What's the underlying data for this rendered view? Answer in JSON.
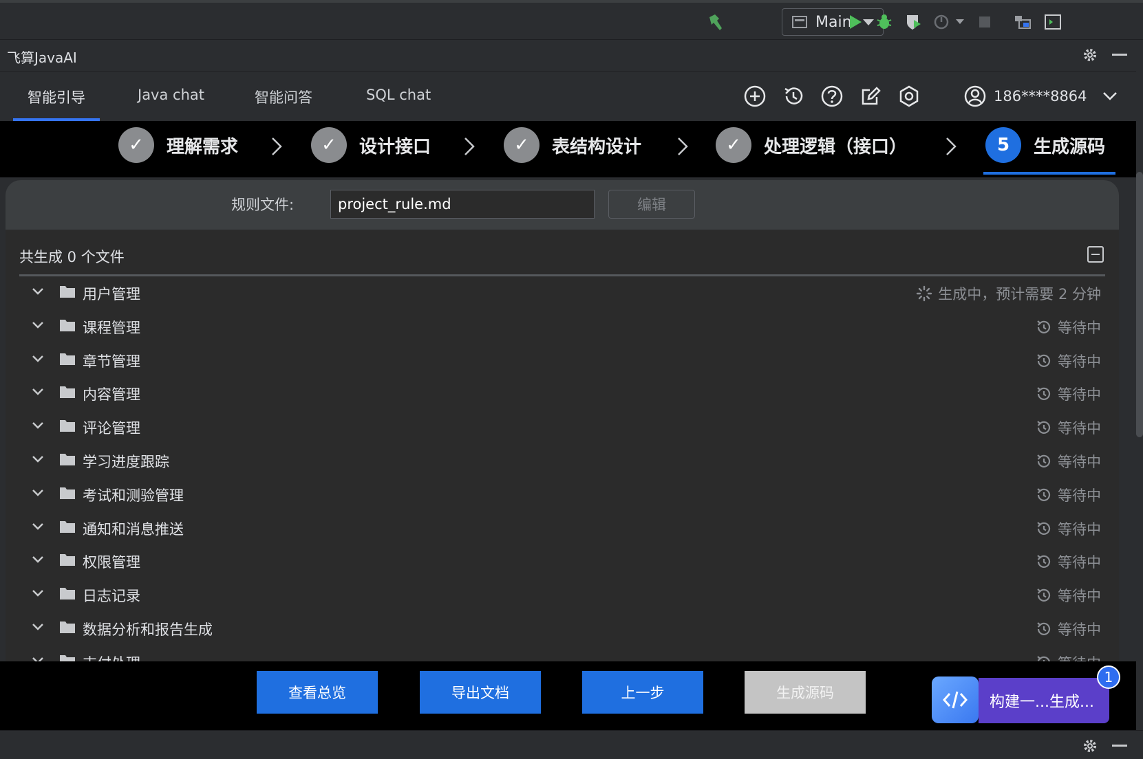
{
  "ide_toolbar": {
    "run_config": "Main",
    "icons": [
      "hammer-icon",
      "run-icon",
      "debug-icon",
      "coverage-icon",
      "profiler-icon",
      "dropdown-icon",
      "stop-icon",
      "project-structure-icon",
      "terminal-icon"
    ]
  },
  "plugin": {
    "title": "飞算JavaAI"
  },
  "tabs": [
    {
      "label": "智能引导",
      "active": true
    },
    {
      "label": "Java chat",
      "active": false
    },
    {
      "label": "智能问答",
      "active": false
    },
    {
      "label": "SQL chat",
      "active": false
    }
  ],
  "header": {
    "user": "186****8864"
  },
  "steps": [
    {
      "label": "理解需求",
      "state": "done",
      "mark": "✓"
    },
    {
      "label": "设计接口",
      "state": "done",
      "mark": "✓"
    },
    {
      "label": "表结构设计",
      "state": "done",
      "mark": "✓"
    },
    {
      "label": "处理逻辑（接口）",
      "state": "done",
      "mark": "✓"
    },
    {
      "label": "生成源码",
      "state": "current",
      "mark": "5"
    }
  ],
  "rule": {
    "label": "规则文件:",
    "value": "project_rule.md",
    "edit_label": "编辑"
  },
  "summary": {
    "text": "共生成 0 个文件"
  },
  "modules": [
    {
      "name": "用户管理",
      "status": "生成中，预计需要 2 分钟",
      "state": "generating"
    },
    {
      "name": "课程管理",
      "status": "等待中",
      "state": "waiting"
    },
    {
      "name": "章节管理",
      "status": "等待中",
      "state": "waiting"
    },
    {
      "name": "内容管理",
      "status": "等待中",
      "state": "waiting"
    },
    {
      "name": "评论管理",
      "status": "等待中",
      "state": "waiting"
    },
    {
      "name": "学习进度跟踪",
      "status": "等待中",
      "state": "waiting"
    },
    {
      "name": "考试和测验管理",
      "status": "等待中",
      "state": "waiting"
    },
    {
      "name": "通知和消息推送",
      "status": "等待中",
      "state": "waiting"
    },
    {
      "name": "权限管理",
      "status": "等待中",
      "state": "waiting"
    },
    {
      "name": "日志记录",
      "status": "等待中",
      "state": "waiting"
    },
    {
      "name": "数据分析和报告生成",
      "status": "等待中",
      "state": "waiting"
    },
    {
      "name": "支付处理",
      "status": "等待中",
      "state": "waiting"
    }
  ],
  "actions": {
    "overview": "查看总览",
    "export": "导出文档",
    "prev": "上一步",
    "generate": "生成源码"
  },
  "floating": {
    "task_label": "构建一...生成...",
    "badge": "1"
  },
  "colors": {
    "accent": "#1f6fe0",
    "step_done": "#8a8c8f",
    "task_bg": "#5b3fc9",
    "disabled": "#c4c4c4"
  }
}
